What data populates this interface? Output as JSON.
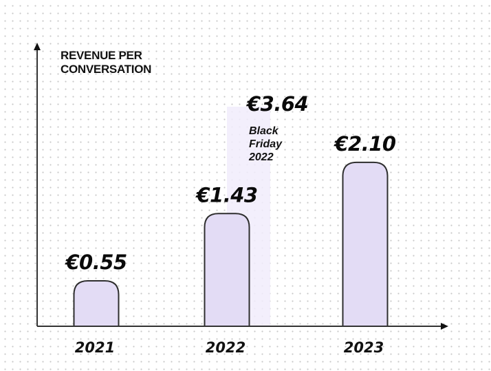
{
  "chart_data": {
    "type": "bar",
    "title": "",
    "ylabel": "REVENUE PER CONVERSATION",
    "ylabel_lines": [
      "REVENUE PER",
      "CONVERSATION"
    ],
    "xlabel": "",
    "categories": [
      "2021",
      "2022",
      "2023"
    ],
    "values": [
      0.55,
      1.43,
      2.1
    ],
    "value_labels": [
      "€0.55",
      "€1.43",
      "€2.10"
    ],
    "currency": "EUR",
    "highlight": {
      "category": "2022",
      "value": 3.64,
      "value_label": "€3.64",
      "annotation_lines": [
        "Black",
        "Friday",
        "2022"
      ]
    },
    "ylim": [
      0,
      4.0
    ],
    "grid": false,
    "legend": "none",
    "colors": {
      "bar_fill": "#e3dcf5",
      "bar_stroke": "#2e2e2e",
      "highlight_fill": "#f1ecfc",
      "axis": "#333333",
      "text": "#0a0a0a"
    }
  }
}
